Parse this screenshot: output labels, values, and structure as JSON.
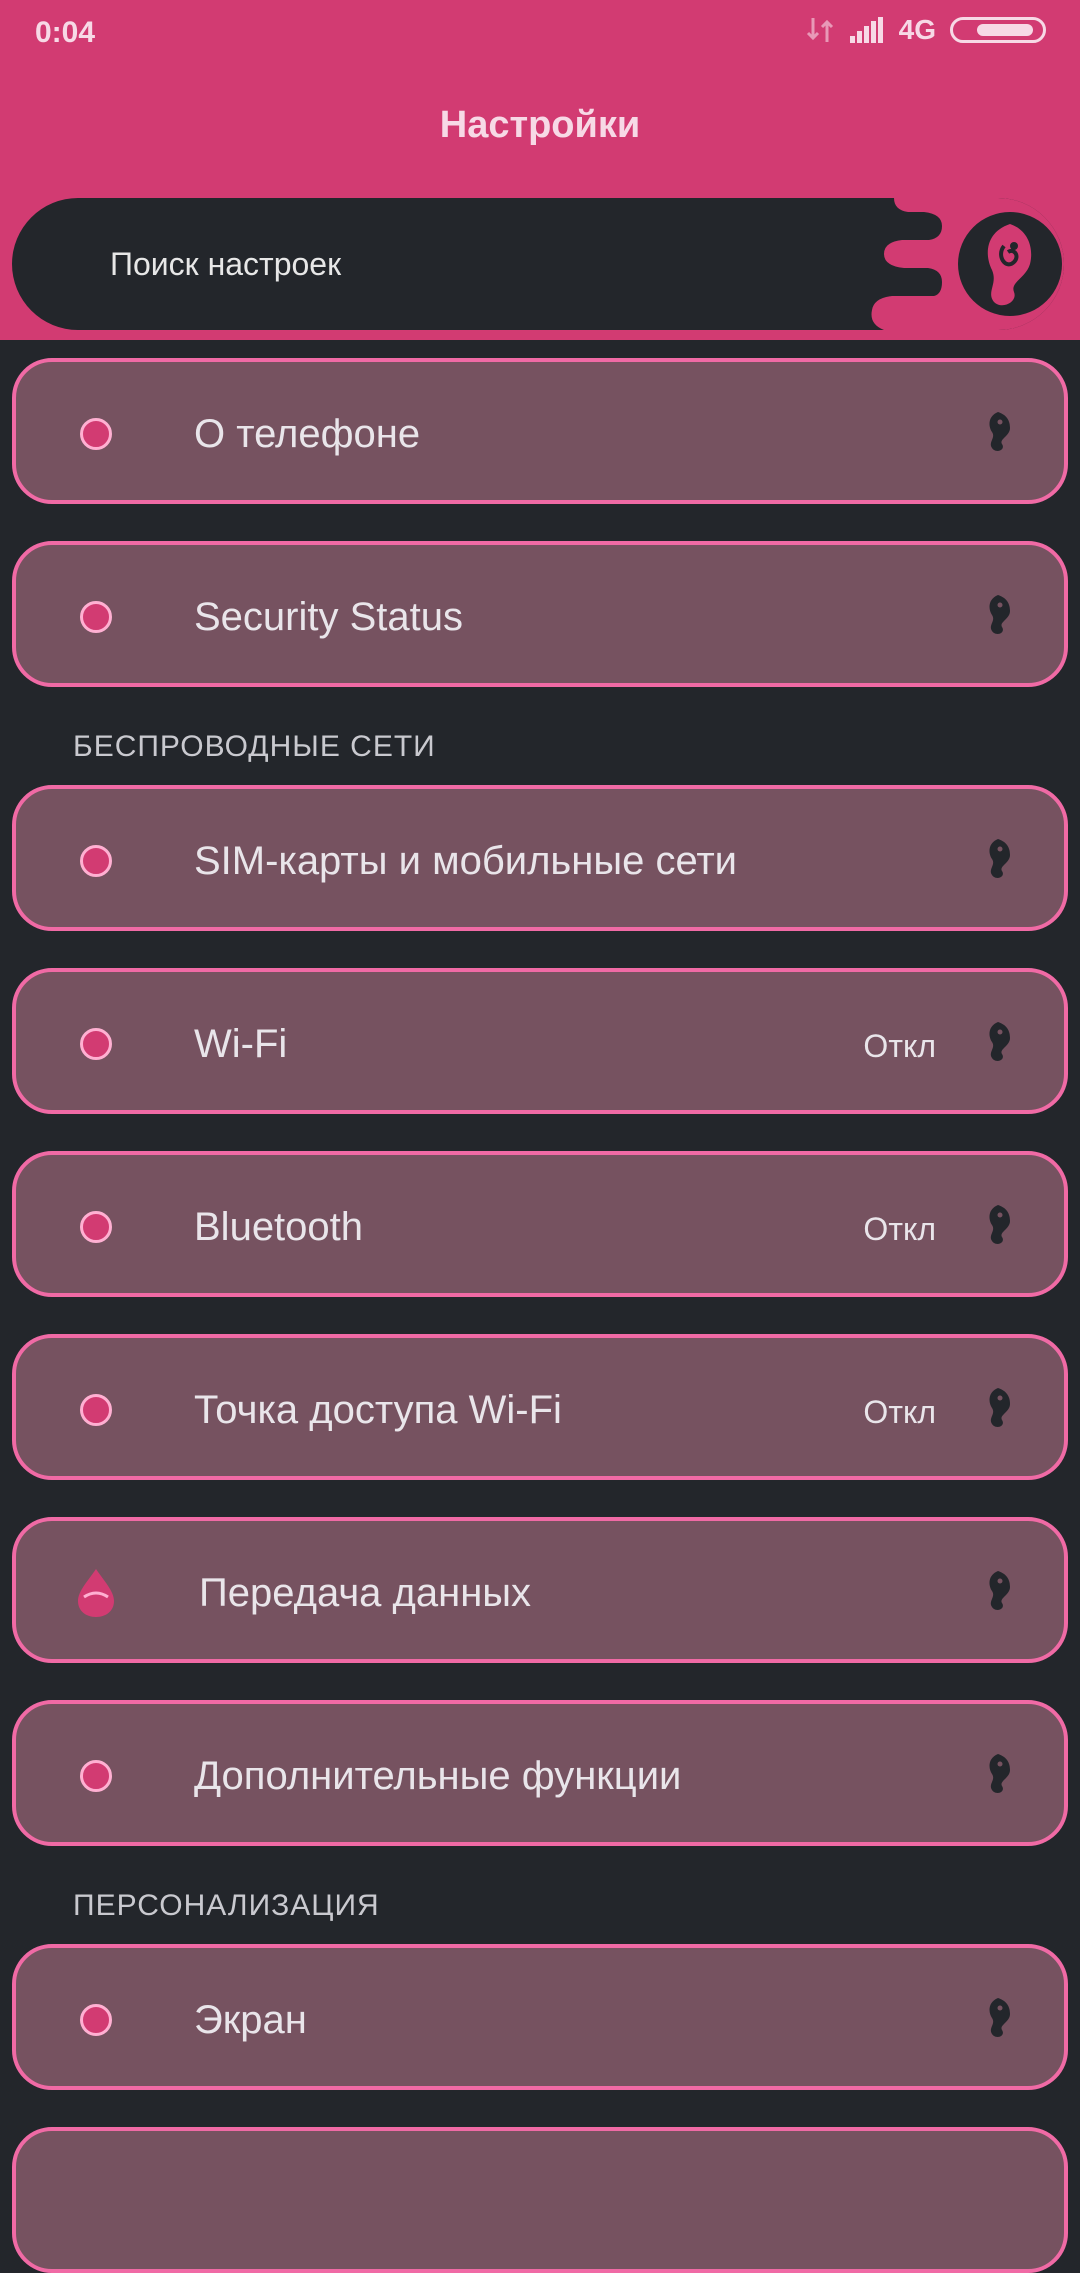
{
  "status": {
    "time": "0:04",
    "network": "4G"
  },
  "header": {
    "title": "Настройки"
  },
  "search": {
    "placeholder": "Поиск настроек"
  },
  "items": [
    {
      "label": "О телефоне",
      "value": ""
    },
    {
      "label": "Security Status",
      "value": ""
    },
    {
      "label": "SIM-карты и мобильные сети",
      "value": ""
    },
    {
      "label": "Wi-Fi",
      "value": "Откл"
    },
    {
      "label": "Bluetooth",
      "value": "Откл"
    },
    {
      "label": "Точка доступа Wi-Fi",
      "value": "Откл"
    },
    {
      "label": "Передача данных",
      "value": ""
    },
    {
      "label": "Дополнительные функции",
      "value": ""
    },
    {
      "label": "Экран",
      "value": ""
    }
  ],
  "sections": {
    "wireless": "БЕСПРОВОДНЫЕ СЕТИ",
    "personalization": "ПЕРСОНАЛИЗАЦИЯ"
  },
  "colors": {
    "accent": "#d23b72",
    "background": "#23262b",
    "card": "#765260",
    "card_border": "#f06aa5"
  },
  "icons": {
    "item": "circle-dot-icon",
    "data_usage": "water-drop-icon",
    "chevron": "seahorse-chevron-icon",
    "search_avatar": "mermaid-avatar-icon"
  }
}
